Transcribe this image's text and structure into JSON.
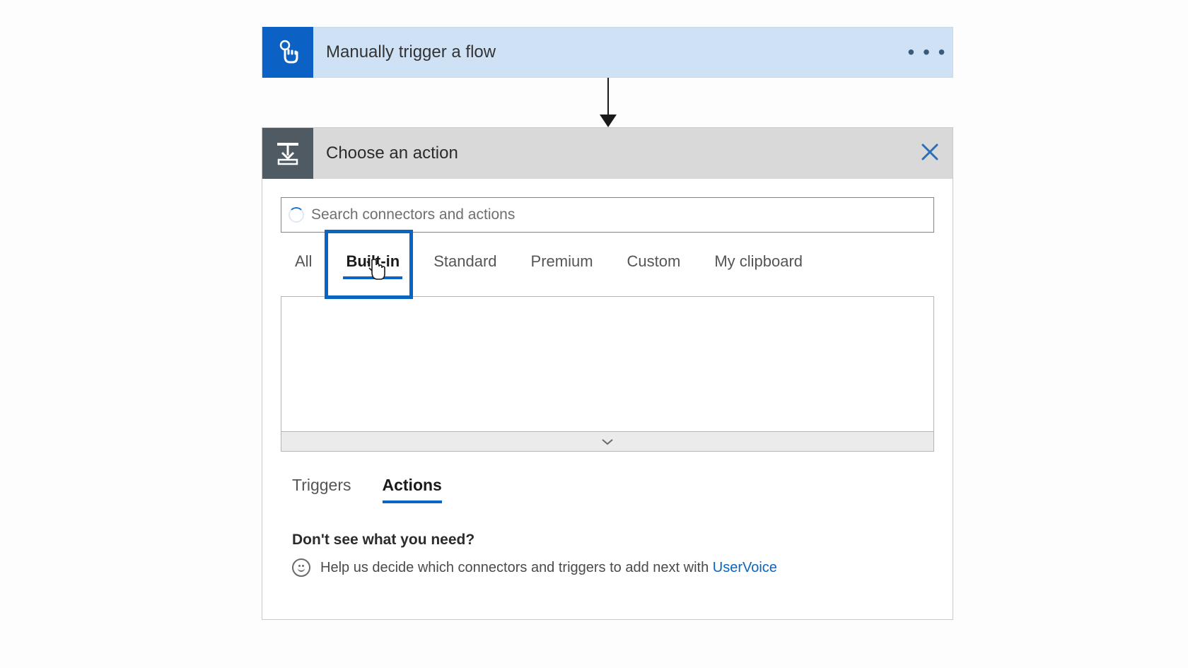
{
  "trigger": {
    "title": "Manually trigger a flow"
  },
  "panel": {
    "title": "Choose an action",
    "search_placeholder": "Search connectors and actions",
    "category_tabs": [
      "All",
      "Built-in",
      "Standard",
      "Premium",
      "Custom",
      "My clipboard"
    ],
    "active_category_index": 1,
    "type_tabs": [
      "Triggers",
      "Actions"
    ],
    "active_type_index": 1,
    "help": {
      "title": "Don't see what you need?",
      "text": "Help us decide which connectors and triggers to add next with ",
      "link_label": "UserVoice"
    }
  }
}
